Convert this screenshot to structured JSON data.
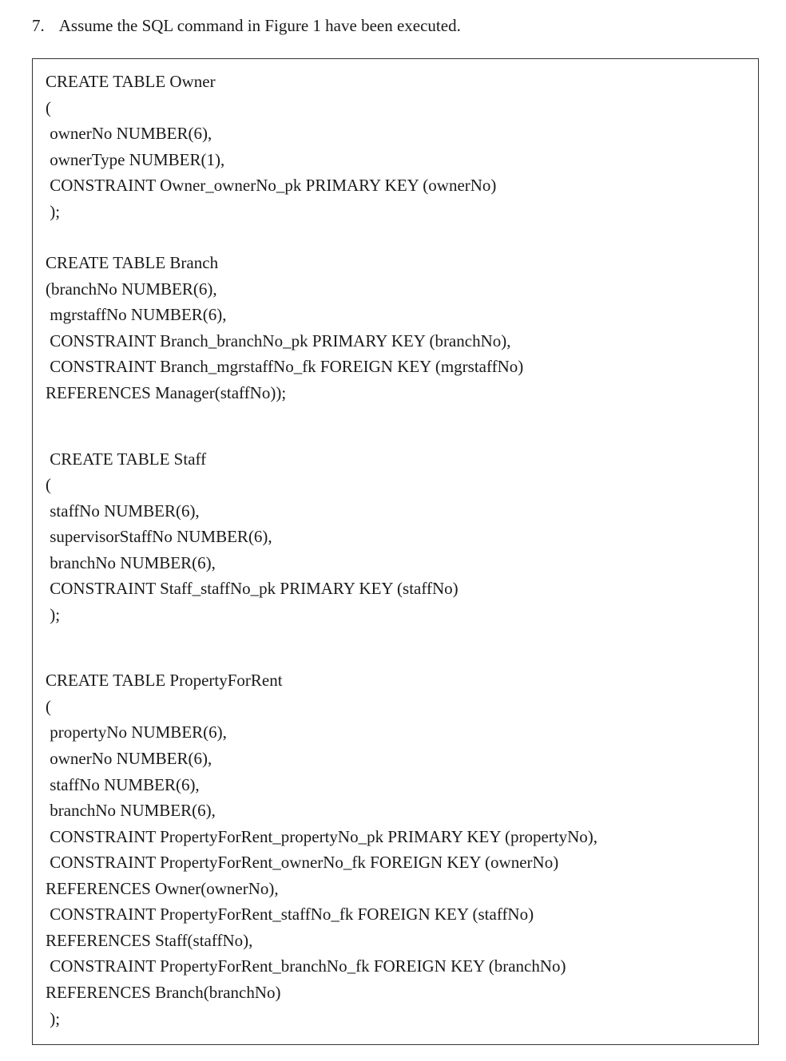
{
  "question": {
    "number": "7.",
    "text": "Assume the SQL command in Figure 1 have been executed."
  },
  "code": {
    "block1": {
      "line1": "CREATE TABLE Owner",
      "line2": "(",
      "line3": " ownerNo NUMBER(6),",
      "line4": " ownerType NUMBER(1),",
      "line5": " CONSTRAINT Owner_ownerNo_pk PRIMARY KEY (ownerNo)",
      "line6": " );"
    },
    "block2": {
      "line1": "CREATE TABLE Branch",
      "line2": "(branchNo NUMBER(6),",
      "line3": " mgrstaffNo NUMBER(6),",
      "line4": " CONSTRAINT Branch_branchNo_pk PRIMARY KEY (branchNo),",
      "line5": " CONSTRAINT Branch_mgrstaffNo_fk FOREIGN KEY (mgrstaffNo)",
      "line6": "REFERENCES Manager(staffNo));"
    },
    "block3": {
      "line1": " CREATE TABLE Staff",
      "line2": "(",
      "line3": " staffNo NUMBER(6),",
      "line4": " supervisorStaffNo NUMBER(6),",
      "line5": " branchNo NUMBER(6),",
      "line6": " CONSTRAINT Staff_staffNo_pk PRIMARY KEY (staffNo)",
      "line7": " );"
    },
    "block4": {
      "line1": "CREATE TABLE PropertyForRent",
      "line2": "(",
      "line3": " propertyNo NUMBER(6),",
      "line4": " ownerNo NUMBER(6),",
      "line5": " staffNo NUMBER(6),",
      "line6": " branchNo NUMBER(6),",
      "line7": " CONSTRAINT PropertyForRent_propertyNo_pk PRIMARY KEY (propertyNo),",
      "line8": " CONSTRAINT PropertyForRent_ownerNo_fk FOREIGN KEY (ownerNo)",
      "line9": "REFERENCES Owner(ownerNo),",
      "line10": " CONSTRAINT PropertyForRent_staffNo_fk FOREIGN KEY (staffNo)",
      "line11": "REFERENCES Staff(staffNo),",
      "line12": " CONSTRAINT PropertyForRent_branchNo_fk FOREIGN KEY (branchNo)",
      "line13": "REFERENCES Branch(branchNo)",
      "line14": " );"
    }
  }
}
